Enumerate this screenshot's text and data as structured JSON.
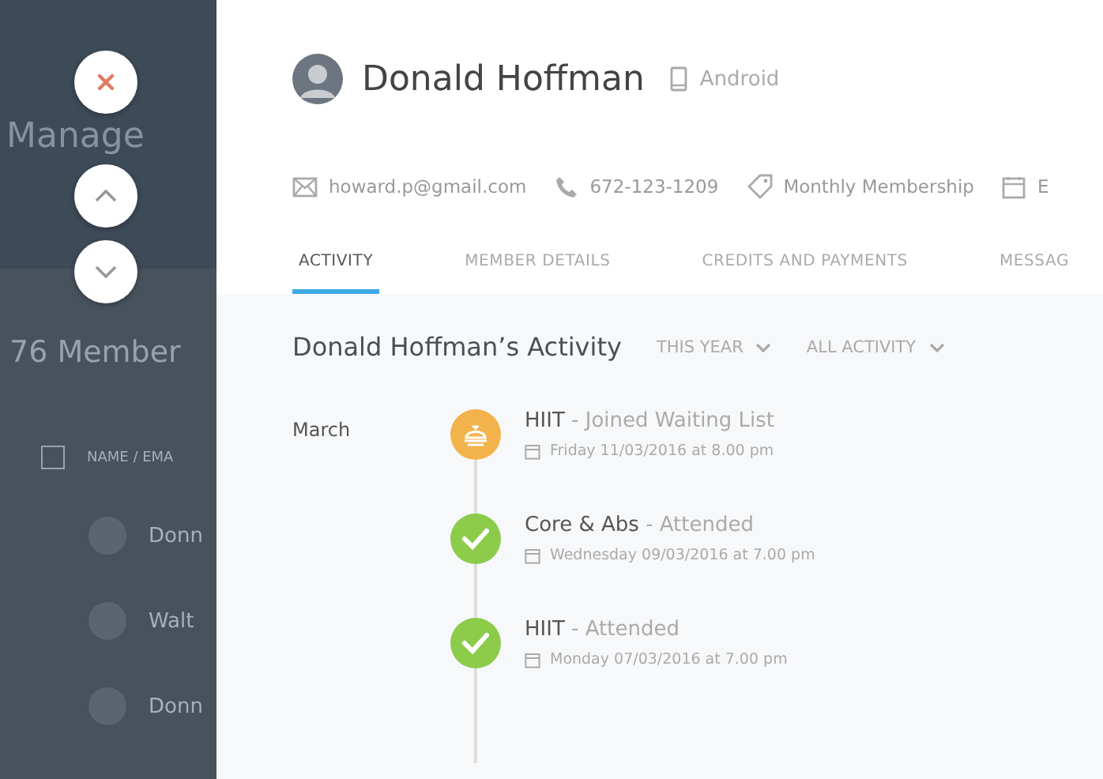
{
  "background_page": {
    "title": "Manage",
    "members_heading": "76 Member",
    "header_checkbox": {
      "checked": false
    },
    "column_header": "NAME / EMA",
    "rows": [
      "Donn",
      "Walt",
      "Donn"
    ]
  },
  "overlay_buttons": [
    {
      "kind": "close"
    },
    {
      "kind": "up"
    },
    {
      "kind": "down"
    }
  ],
  "member": {
    "name": "Donald Hoffman",
    "device": "Android"
  },
  "contacts": [
    {
      "kind": "email",
      "text": "howard.p@gmail.com"
    },
    {
      "kind": "phone",
      "text": "672-123-1209"
    },
    {
      "kind": "tag",
      "text": "Monthly Membership"
    },
    {
      "kind": "calendar",
      "text": "E"
    }
  ],
  "tabs": [
    {
      "label": "ACTIVITY",
      "selected": true
    },
    {
      "label": "MEMBER DETAILS",
      "selected": false
    },
    {
      "label": "CREDITS AND PAYMENTS",
      "selected": false
    },
    {
      "label": "MESSAG",
      "selected": false
    }
  ],
  "activity": {
    "title": "Donald Hoffman’s Activity",
    "filters": [
      "THIS YEAR",
      "ALL ACTIVITY"
    ],
    "month": "March",
    "events": [
      {
        "kind": "waiting",
        "class": "HIIT",
        "status": "- Joined Waiting List",
        "date": "Friday 11/03/2016 at 8.00 pm"
      },
      {
        "kind": "attended",
        "class": "Core & Abs",
        "status": "- Attended",
        "date": "Wednesday 09/03/2016 at 7.00 pm"
      },
      {
        "kind": "attended",
        "class": "HIIT",
        "status": "- Attended",
        "date": "Monday 07/03/2016 at 7.00 pm"
      }
    ]
  }
}
